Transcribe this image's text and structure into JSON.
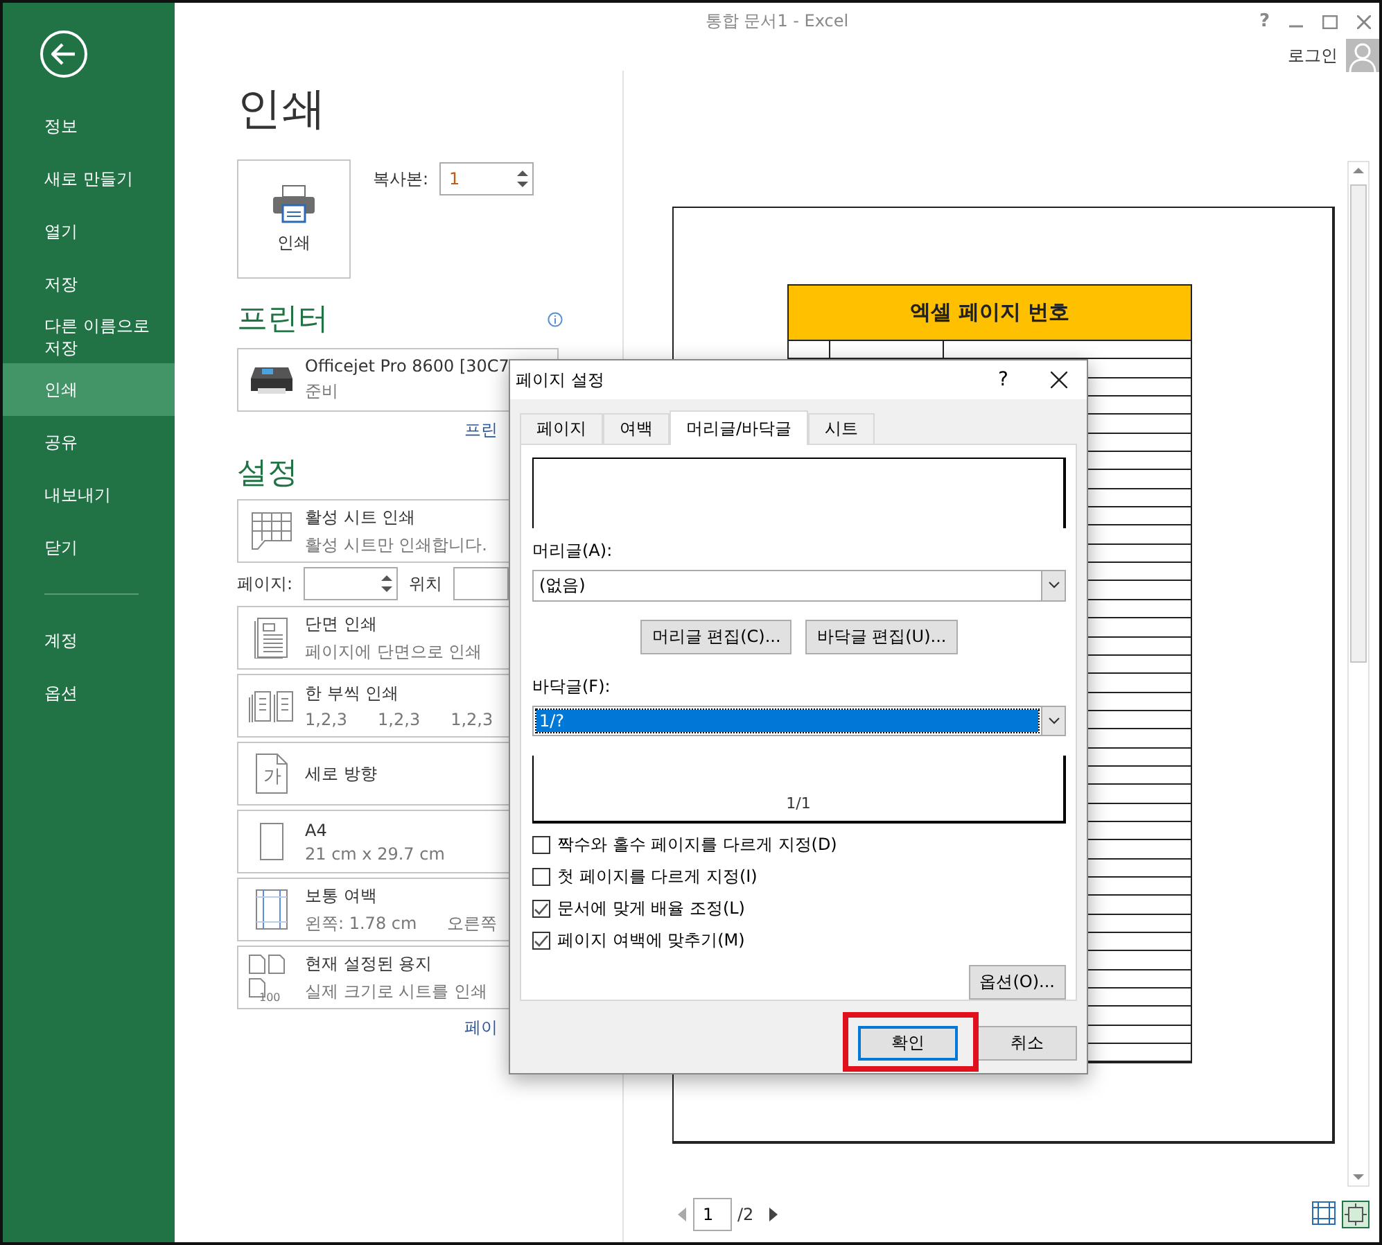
{
  "window": {
    "title": "통합 문서1 - Excel",
    "help": "?"
  },
  "account": {
    "label": "로그인"
  },
  "sidebar": {
    "items": [
      {
        "label": "정보",
        "selected": false
      },
      {
        "label": "새로 만들기",
        "selected": false
      },
      {
        "label": "열기",
        "selected": false
      },
      {
        "label": "저장",
        "selected": false
      },
      {
        "label": "다른 이름으로 저장",
        "selected": false
      },
      {
        "label": "인쇄",
        "selected": true
      },
      {
        "label": "공유",
        "selected": false
      },
      {
        "label": "내보내기",
        "selected": false
      },
      {
        "label": "닫기",
        "selected": false
      }
    ],
    "footer_items": [
      {
        "label": "계정",
        "selected": false
      },
      {
        "label": "옵션",
        "selected": false
      }
    ]
  },
  "page_title": "인쇄",
  "print_button": {
    "label": "인쇄"
  },
  "copies": {
    "label": "복사본:",
    "value": "1"
  },
  "printer": {
    "heading": "프린터",
    "name": "Officejet Pro 8600 [30C7",
    "status": "준비",
    "link": "프린"
  },
  "settings": {
    "heading": "설정",
    "items": [
      {
        "kind": "sheet",
        "title": "활성 시트 인쇄",
        "details": [
          "활성 시트만 인쇄합니다."
        ]
      },
      {
        "kind": "onesided",
        "title": "단면 인쇄",
        "details": [
          "페이지에 단면으로 인쇄"
        ]
      },
      {
        "kind": "collated",
        "title": "한 부씩 인쇄",
        "details": [
          "1,2,3",
          "1,2,3",
          "1,2,3"
        ]
      },
      {
        "kind": "portrait",
        "title": "세로 방향",
        "icon_text": "가"
      },
      {
        "kind": "paper",
        "title": "A4",
        "details": [
          "21 cm x 29.7 cm"
        ]
      },
      {
        "kind": "margins",
        "title": "보통 여백",
        "details": [
          "왼쪽:  1.78 cm",
          "오른쪽"
        ]
      },
      {
        "kind": "scaling",
        "title": "현재 설정된 용지",
        "icon_text": "100",
        "details": [
          "실제 크기로 시트를 인쇄"
        ]
      }
    ],
    "pages": {
      "label": "페이지:",
      "to_label": "위치"
    },
    "link": "페이"
  },
  "preview": {
    "sheet_title": "엑셀 페이지 번호",
    "page_number": "1",
    "page_total": "/2"
  },
  "dialog": {
    "title": "페이지 설정",
    "help": "?",
    "tabs": [
      {
        "label": "페이지",
        "selected": false
      },
      {
        "label": "여백",
        "selected": false
      },
      {
        "label": "머리글/바닥글",
        "selected": true
      },
      {
        "label": "시트",
        "selected": false
      }
    ],
    "header_label": "머리글(A):",
    "header_value": "(없음)",
    "edit_buttons": [
      "머리글 편집(C)...",
      "바닥글 편집(U)..."
    ],
    "footer_label": "바닥글(F):",
    "footer_value": "1/?",
    "footer_preview": "1/1",
    "options": [
      {
        "label": "짝수와 홀수 페이지를 다르게 지정(D)",
        "checked": false
      },
      {
        "label": "첫 페이지를 다르게 지정(I)",
        "checked": false
      },
      {
        "label": "문서에 맞게 배율 조정(L)",
        "checked": true
      },
      {
        "label": "페이지 여백에 맞추기(M)",
        "checked": true
      }
    ],
    "options_button": "옵션(O)...",
    "buttons": [
      {
        "label": "확인",
        "default": true,
        "highlighted": true
      },
      {
        "label": "취소",
        "default": false,
        "highlighted": false
      }
    ]
  }
}
